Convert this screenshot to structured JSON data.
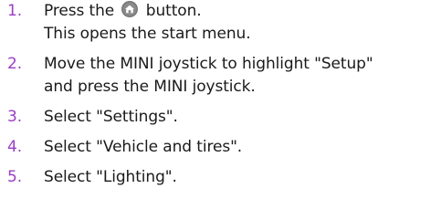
{
  "steps": [
    {
      "number": "1.",
      "parts": [
        "Press the",
        "button."
      ],
      "icon": "home-button-icon",
      "note": "This opens the start menu."
    },
    {
      "number": "2.",
      "lines": [
        "Move the MINI joystick to highlight \"Setup\"",
        "and press the MINI joystick."
      ]
    },
    {
      "number": "3.",
      "text": "Select \"Settings\"."
    },
    {
      "number": "4.",
      "text": "Select \"Vehicle and tires\"."
    },
    {
      "number": "5.",
      "text": "Select \"Lighting\"."
    }
  ],
  "colors": {
    "step_number": "#9a3ec4",
    "text": "#1a1a1a",
    "icon_fill": "#8a8a8a"
  }
}
